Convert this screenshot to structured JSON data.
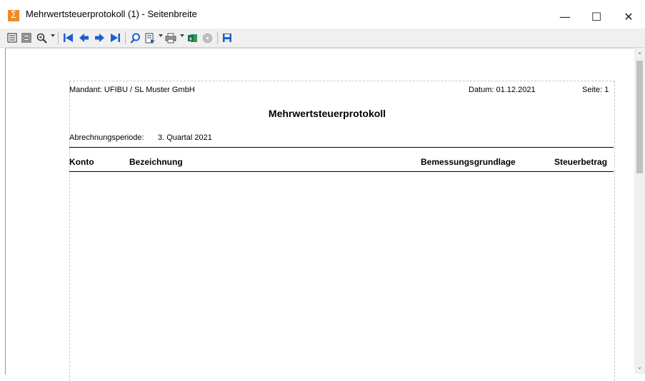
{
  "window": {
    "title": "Mehrwertsteuerprotokoll (1) - Seitenbreite",
    "app_icon": "sigma-icon",
    "controls": {
      "minimize": "—",
      "maximize": "☐",
      "close": "✕"
    }
  },
  "toolbar": {
    "icons": [
      "single-page-icon",
      "two-pages-icon",
      "zoom-icon",
      "first-page-icon",
      "previous-page-icon",
      "next-page-icon",
      "last-page-icon",
      "search-icon",
      "export-icon",
      "print-icon",
      "excel-icon",
      "settings-icon",
      "save-icon"
    ]
  },
  "scrollbar": {
    "up_arrow": "⌃",
    "down_arrow": "⌄"
  },
  "report": {
    "mandant": "Mandant: UFIBU / SL Muster GmbH",
    "datum": "Datum:  01.12.2021",
    "seite": "Seite: 1",
    "title": "Mehrwertsteuerprotokoll",
    "periode_label": "Abrechnungsperiode:",
    "periode_value": "3. Quartal 2021",
    "columns": [
      "Konto",
      "Bezeichnung",
      "Bemessungsgrundlage",
      "Steuerbetrag"
    ]
  },
  "colors": {
    "accent_blue": "#1a5fd0",
    "title_icon": "#f08a24",
    "excel_green": "#1d7044"
  }
}
